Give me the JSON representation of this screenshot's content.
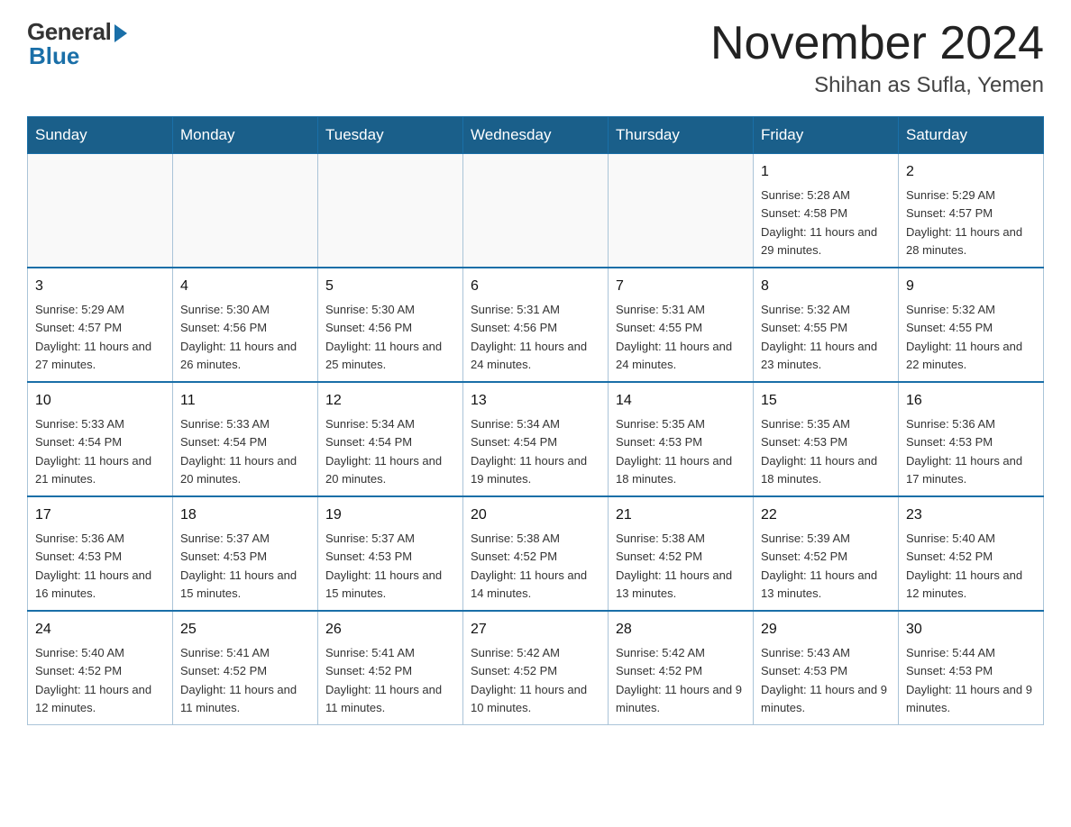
{
  "header": {
    "logo": {
      "general": "General",
      "blue": "Blue"
    },
    "title": "November 2024",
    "location": "Shihan as Sufla, Yemen"
  },
  "days_of_week": [
    "Sunday",
    "Monday",
    "Tuesday",
    "Wednesday",
    "Thursday",
    "Friday",
    "Saturday"
  ],
  "weeks": [
    [
      {
        "day": "",
        "info": ""
      },
      {
        "day": "",
        "info": ""
      },
      {
        "day": "",
        "info": ""
      },
      {
        "day": "",
        "info": ""
      },
      {
        "day": "",
        "info": ""
      },
      {
        "day": "1",
        "info": "Sunrise: 5:28 AM\nSunset: 4:58 PM\nDaylight: 11 hours and 29 minutes."
      },
      {
        "day": "2",
        "info": "Sunrise: 5:29 AM\nSunset: 4:57 PM\nDaylight: 11 hours and 28 minutes."
      }
    ],
    [
      {
        "day": "3",
        "info": "Sunrise: 5:29 AM\nSunset: 4:57 PM\nDaylight: 11 hours and 27 minutes."
      },
      {
        "day": "4",
        "info": "Sunrise: 5:30 AM\nSunset: 4:56 PM\nDaylight: 11 hours and 26 minutes."
      },
      {
        "day": "5",
        "info": "Sunrise: 5:30 AM\nSunset: 4:56 PM\nDaylight: 11 hours and 25 minutes."
      },
      {
        "day": "6",
        "info": "Sunrise: 5:31 AM\nSunset: 4:56 PM\nDaylight: 11 hours and 24 minutes."
      },
      {
        "day": "7",
        "info": "Sunrise: 5:31 AM\nSunset: 4:55 PM\nDaylight: 11 hours and 24 minutes."
      },
      {
        "day": "8",
        "info": "Sunrise: 5:32 AM\nSunset: 4:55 PM\nDaylight: 11 hours and 23 minutes."
      },
      {
        "day": "9",
        "info": "Sunrise: 5:32 AM\nSunset: 4:55 PM\nDaylight: 11 hours and 22 minutes."
      }
    ],
    [
      {
        "day": "10",
        "info": "Sunrise: 5:33 AM\nSunset: 4:54 PM\nDaylight: 11 hours and 21 minutes."
      },
      {
        "day": "11",
        "info": "Sunrise: 5:33 AM\nSunset: 4:54 PM\nDaylight: 11 hours and 20 minutes."
      },
      {
        "day": "12",
        "info": "Sunrise: 5:34 AM\nSunset: 4:54 PM\nDaylight: 11 hours and 20 minutes."
      },
      {
        "day": "13",
        "info": "Sunrise: 5:34 AM\nSunset: 4:54 PM\nDaylight: 11 hours and 19 minutes."
      },
      {
        "day": "14",
        "info": "Sunrise: 5:35 AM\nSunset: 4:53 PM\nDaylight: 11 hours and 18 minutes."
      },
      {
        "day": "15",
        "info": "Sunrise: 5:35 AM\nSunset: 4:53 PM\nDaylight: 11 hours and 18 minutes."
      },
      {
        "day": "16",
        "info": "Sunrise: 5:36 AM\nSunset: 4:53 PM\nDaylight: 11 hours and 17 minutes."
      }
    ],
    [
      {
        "day": "17",
        "info": "Sunrise: 5:36 AM\nSunset: 4:53 PM\nDaylight: 11 hours and 16 minutes."
      },
      {
        "day": "18",
        "info": "Sunrise: 5:37 AM\nSunset: 4:53 PM\nDaylight: 11 hours and 15 minutes."
      },
      {
        "day": "19",
        "info": "Sunrise: 5:37 AM\nSunset: 4:53 PM\nDaylight: 11 hours and 15 minutes."
      },
      {
        "day": "20",
        "info": "Sunrise: 5:38 AM\nSunset: 4:52 PM\nDaylight: 11 hours and 14 minutes."
      },
      {
        "day": "21",
        "info": "Sunrise: 5:38 AM\nSunset: 4:52 PM\nDaylight: 11 hours and 13 minutes."
      },
      {
        "day": "22",
        "info": "Sunrise: 5:39 AM\nSunset: 4:52 PM\nDaylight: 11 hours and 13 minutes."
      },
      {
        "day": "23",
        "info": "Sunrise: 5:40 AM\nSunset: 4:52 PM\nDaylight: 11 hours and 12 minutes."
      }
    ],
    [
      {
        "day": "24",
        "info": "Sunrise: 5:40 AM\nSunset: 4:52 PM\nDaylight: 11 hours and 12 minutes."
      },
      {
        "day": "25",
        "info": "Sunrise: 5:41 AM\nSunset: 4:52 PM\nDaylight: 11 hours and 11 minutes."
      },
      {
        "day": "26",
        "info": "Sunrise: 5:41 AM\nSunset: 4:52 PM\nDaylight: 11 hours and 11 minutes."
      },
      {
        "day": "27",
        "info": "Sunrise: 5:42 AM\nSunset: 4:52 PM\nDaylight: 11 hours and 10 minutes."
      },
      {
        "day": "28",
        "info": "Sunrise: 5:42 AM\nSunset: 4:52 PM\nDaylight: 11 hours and 9 minutes."
      },
      {
        "day": "29",
        "info": "Sunrise: 5:43 AM\nSunset: 4:53 PM\nDaylight: 11 hours and 9 minutes."
      },
      {
        "day": "30",
        "info": "Sunrise: 5:44 AM\nSunset: 4:53 PM\nDaylight: 11 hours and 9 minutes."
      }
    ]
  ]
}
